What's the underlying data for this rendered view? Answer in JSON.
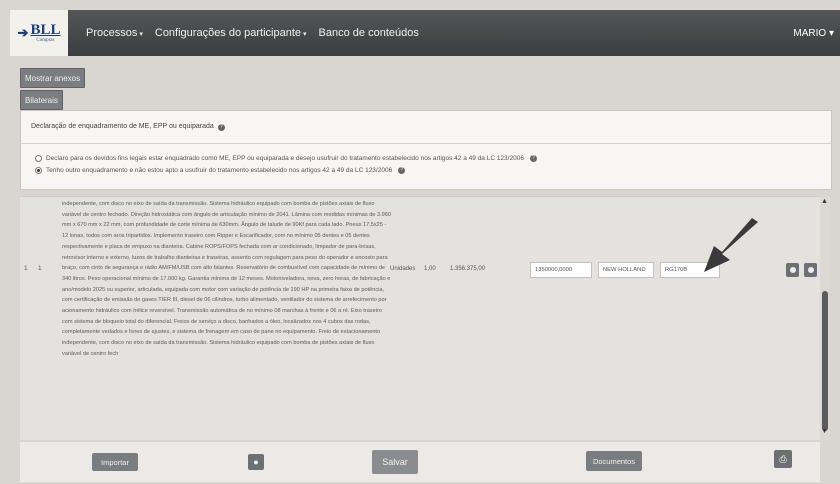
{
  "header": {
    "logo_name": "BLL",
    "logo_sub": "Compras",
    "nav": [
      {
        "label": "Processos",
        "caret": "▾"
      },
      {
        "label": "Configurações do participante",
        "caret": "▾"
      },
      {
        "label": "Banco de conteúdos",
        "caret": ""
      }
    ],
    "user": "MARIO ▾"
  },
  "buttons": {
    "mostrar_anexos": "Mostrar anexos",
    "bilaterais": "Bilaterais"
  },
  "declaration": {
    "title": "Declaração de enquadramento de ME, EPP ou equiparada",
    "option1": "Declaro para os devidos fins legais estar enquadrado como ME, EPP ou equiparada e desejo usufruir do tratamento estabelecido nos artigos 42 a 49 da LC 123/2006",
    "option2": "Tenho outro enquadramento e não estou apto a usufruir do tratamento estabelecido nos artigos 42 a 49 da LC 123/2006",
    "selected": 2
  },
  "item": {
    "col1": "1",
    "col2": "1",
    "description": "independente, com disco no eixo de saída da transmissão. Sistema hidráulico equipado com bomba de pistões axiais de fluxo variável de centro fechado. Direção hidrostática com ângulo de articulação mínimo de 2041. Lâmina com medidas mínimas de 3.960 mm x 670 mm x 22 mm, com profundidade de corte mínima de 630mm. Ângulo de talude de 90Kf para cada lado. Pneus 17,5x25 - 12 lonas, todos com aros tripartidos. Implemento traseiro com Ripper e Escarificador, com no mínimo 05 dentes e 05 dentes respectivamente e placa de empuxo na dianteira. Cabine ROPS/FOPS fechada com ar condicionado, limpador de para-brisas, retrovisor interno e externo, luzes de trabalho dianteiras e traseiras, assento com regulagem para peso do operador e encosto para braço, com cinto de segurança e rádio AM/FM/USB com alto falantes. Reservatório de combustível com capacidade de mínimo de 340 litros. Peso operacional mínimo de 17.000 kg. Garantia mínima de 12 meses. Motoniveladora, nova, zero horas, de fabricação e ano/modelo 2025 ou superior, articulada, equipada com motor com variação de potência de 190 HP na primeira faixa de potência, com certificação de emissão de gases TIER III, diesel de 06 cilindros, turbo alimentado, ventilador do sistema de arrefecimento por acionamento hidráulico com hélice reversível. Transmissão automática de no mínimo 08 marchas à frente e 06 a ré. Eixo traseiro com sistema de bloqueio total do diferencial. Freios de serviço a disco, banhados a óleo, localizados nos 4 cubos das rodas, completamente vedados e livres de ajustes, e sistema de frenagem em caso de pane no equipamento. Freio de estacionamento independente, com disco no eixo de saída da transmissão. Sistema hidráulico equipado com bomba de pistões axiais de fluxo variável de centro fech",
    "unit": "Unidades",
    "quantity": "1,00",
    "total": "1.356.375,00",
    "price_value": "1350000,0000",
    "brand_value": "NEW HOLLAND",
    "model_value": "RG170B"
  },
  "footer": {
    "importar": "Importar",
    "salvar": "Salvar",
    "documentos": "Documentos"
  },
  "colors": {
    "topbar": "#3b3d40",
    "button": "#7a7c7f",
    "logo": "#1e3f7a"
  }
}
